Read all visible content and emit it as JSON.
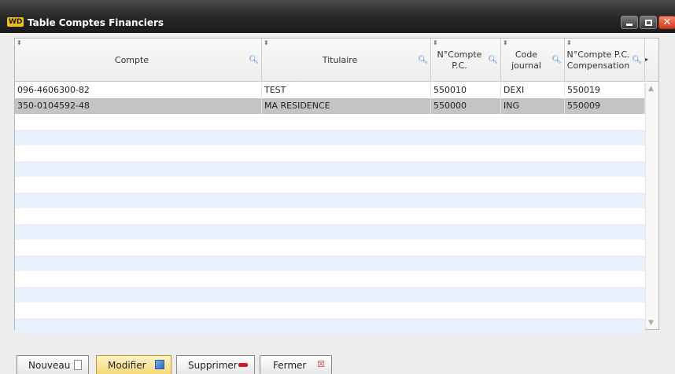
{
  "window": {
    "app_icon": "WD",
    "title": "Table Comptes Financiers"
  },
  "table": {
    "columns": [
      {
        "label": "Compte"
      },
      {
        "label": "Titulaire"
      },
      {
        "label": "N°Compte P.C."
      },
      {
        "label": "Code journal"
      },
      {
        "label": "N°Compte P.C. Compensation"
      }
    ],
    "rows": [
      {
        "compte": "096-4606300-82",
        "titulaire": "TEST",
        "pc": "550010",
        "journal": "DEXI",
        "compensation": "550019"
      },
      {
        "compte": "350-0104592-48",
        "titulaire": "MA RESIDENCE",
        "pc": "550000",
        "journal": "ING",
        "compensation": "550009"
      }
    ],
    "selected_row_index": 1
  },
  "buttons": {
    "new": "Nouveau",
    "edit": "Modifier",
    "delete": "Supprimer",
    "close": "Fermer"
  },
  "icons": {
    "sort": "sort-icon",
    "search": "search-icon",
    "minimize": "minimize-icon",
    "maximize": "maximize-icon",
    "close": "close-icon"
  },
  "colors": {
    "selected_row": "#c4c4c4",
    "alt_row": "#e8f1fb",
    "search_icon": "#2a6fd1",
    "close_button": "#d1391c"
  }
}
